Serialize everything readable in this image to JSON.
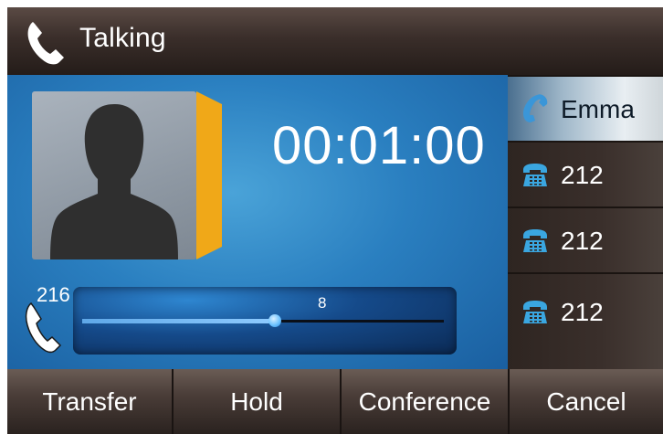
{
  "status": {
    "title": "Talking",
    "icon": "handset-icon"
  },
  "call": {
    "timer": "00:01:00",
    "local_line": "216",
    "contact_icon": "person-silhouette-icon"
  },
  "volume": {
    "label": "8",
    "value": 8,
    "max": 15
  },
  "lines": [
    {
      "label": "Emma",
      "icon": "handset-icon",
      "active": true
    },
    {
      "label": "212",
      "icon": "desk-phone-icon",
      "active": false
    },
    {
      "label": "212",
      "icon": "desk-phone-icon",
      "active": false
    },
    {
      "label": "212",
      "icon": "desk-phone-icon",
      "active": false
    }
  ],
  "softkeys": [
    {
      "label": "Transfer"
    },
    {
      "label": "Hold"
    },
    {
      "label": "Conference"
    },
    {
      "label": "Cancel"
    }
  ],
  "colors": {
    "accent_blue": "#2a7fc0",
    "avatar_tab": "#f0a818",
    "handset_blue": "#3a96d8"
  }
}
